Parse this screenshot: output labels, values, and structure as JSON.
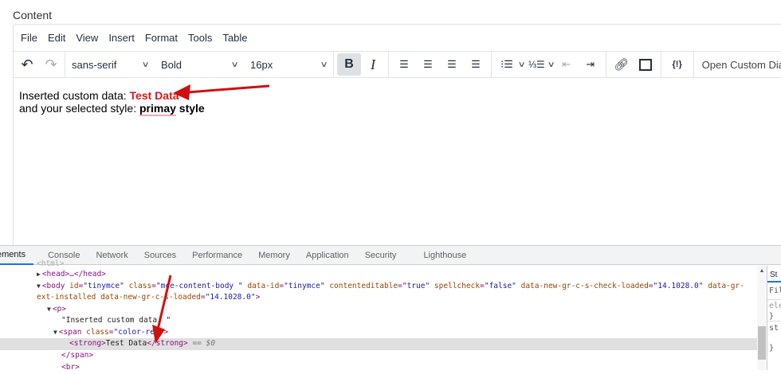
{
  "label": "Content",
  "menu": [
    "File",
    "Edit",
    "View",
    "Insert",
    "Format",
    "Tools",
    "Table"
  ],
  "toolbar": {
    "font_family": "sans-serif",
    "font_weight": "Bold",
    "font_size": "16px",
    "custom_button": "Open Custom Dia"
  },
  "content": {
    "line1_prefix": "Inserted custom data: ",
    "line1_value": "Test Data",
    "line2_prefix": "and your selected style: ",
    "line2_word1": "primay",
    "line2_rest": " style"
  },
  "devtools": {
    "tabs": [
      "ements",
      "Console",
      "Network",
      "Sources",
      "Performance",
      "Memory",
      "Application",
      "Security",
      "Lighthouse"
    ],
    "lines": {
      "html": "<html>",
      "head": "<head>…</head>",
      "body_open": "<body",
      "id_attr": "id",
      "id_val": "\"tinymce\"",
      "class_attr": "class",
      "class_val": "\"mce-content-body \"",
      "dataid_attr": "data-id",
      "dataid_val": "\"tinymce\"",
      "ce_attr": "contenteditable",
      "ce_val": "\"true\"",
      "sc_attr": "spellcheck",
      "sc_val": "\"false\"",
      "gr1_attr": "data-new-gr-c-s-check-loaded",
      "gr1_val": "\"14.1028.0\"",
      "gr2_attr": "data-gr-",
      "gr2b_attr": "ext-installed data-new-gr-c-s-loaded",
      "gr2_val": "\"14.1028.0\"",
      "close": ">",
      "p": "<p>",
      "text": "\"Inserted custom data: \"",
      "span_open": "<span",
      "span_class_attr": "class",
      "span_class_val": "\"color-red\"",
      "strong_open": "<strong>",
      "strong_text": "Test Data",
      "strong_close": "</strong>",
      "sel_marker": " == $0",
      "span_close": "</span>",
      "br": "<br>"
    },
    "side": [
      "St",
      "Fil",
      "ele",
      "}",
      "st",
      "}"
    ]
  }
}
